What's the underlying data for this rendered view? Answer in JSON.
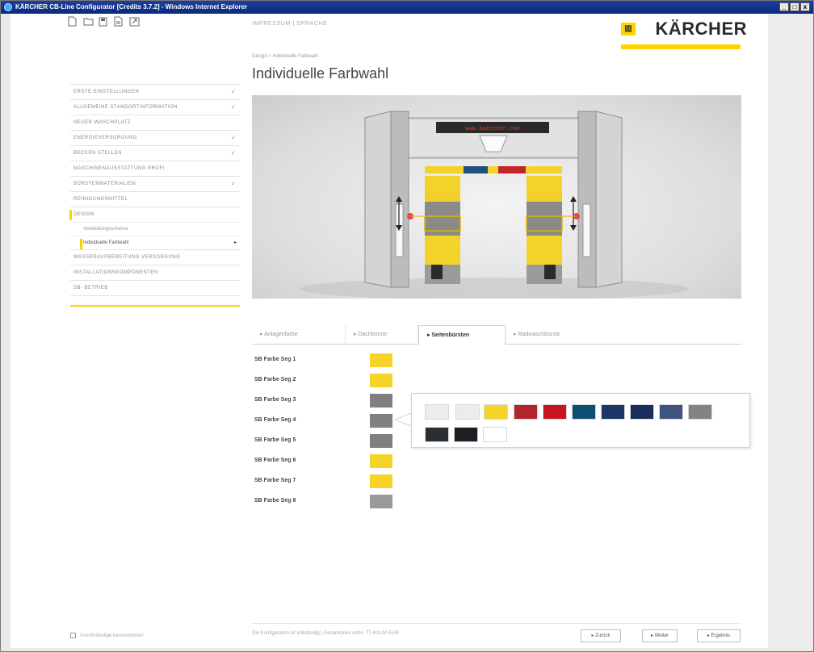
{
  "window": {
    "title": "KÄRCHER CB-Line Configurator [Credits 3.7.2] - Windows Internet Explorer",
    "controls": [
      "_",
      "□",
      "x"
    ]
  },
  "toolbar": {
    "icons": [
      "new-document-icon",
      "open-folder-icon",
      "save-icon",
      "print-icon",
      "export-icon"
    ]
  },
  "top_links": "IMPRESSUM | SPRACHE",
  "logo": {
    "text": "KÄRCHER",
    "accent": "#ffd200"
  },
  "breadcrumb": "Design > Individuelle Farbwahl",
  "page_title": "Individuelle Farbwahl",
  "sidebar": {
    "items": [
      {
        "label": "ERSTE EINSTELLUNGEN",
        "checked": "✓"
      },
      {
        "label": "ALLGEMEINE STANDORTINFORMATION",
        "checked": "✓"
      },
      {
        "label": "NEUER WASCHPLATZ",
        "checked": ""
      },
      {
        "label": "ENERGIEVERSORGUNG",
        "checked": "✓"
      },
      {
        "label": "BECKEN STELLEN",
        "checked": "✓"
      },
      {
        "label": "MASCHINENAUSSTATTUNG PROFI",
        "checked": ""
      },
      {
        "label": "BÜRSTENMATERIALIEN",
        "checked": "✓"
      },
      {
        "label": "REINIGUNGSMITTEL",
        "checked": ""
      },
      {
        "label": "DESIGN",
        "checked": ""
      }
    ],
    "sub_items": [
      {
        "label": "Verkleidungsschema",
        "marker": ""
      },
      {
        "label": "Individuelle Farbwahl",
        "marker": "▸"
      }
    ],
    "items_after": [
      {
        "label": "WASSERAUFBEREITUNG VERSORGUNG",
        "checked": ""
      },
      {
        "label": "INSTALLATIONSKOMPONENTEN",
        "checked": ""
      },
      {
        "label": "SB- BETRIEB",
        "checked": ""
      }
    ]
  },
  "hero": {
    "display_text": "www.kaercher.com"
  },
  "tabs": [
    {
      "label": "▸ Anlagenfarbe"
    },
    {
      "label": "▸ Dachbürste"
    },
    {
      "label": "▸ Seitenbürsten"
    },
    {
      "label": "▸ Radwaschbürste"
    }
  ],
  "segments": [
    {
      "label": "SB Farbe Seg 1",
      "color": "#f5d328"
    },
    {
      "label": "SB Farbe Seg 2",
      "color": "#f5d328"
    },
    {
      "label": "SB Farbe Seg 3",
      "color": "#808080"
    },
    {
      "label": "SB Farbe Seg 4",
      "color": "#808080"
    },
    {
      "label": "SB Farbe Seg 5",
      "color": "#808080"
    },
    {
      "label": "SB Farbe Seg 6",
      "color": "#f5d328"
    },
    {
      "label": "SB Farbe Seg 7",
      "color": "#f5d328"
    },
    {
      "label": "SB Farbe Seg 8",
      "color": "#9a9a9a"
    }
  ],
  "palette": {
    "row1": [
      "#ececec",
      "#ececec",
      "#f5d328",
      "#b0262a",
      "#c8141e",
      "#0e4e73",
      "#1a3566",
      "#1a2e5c",
      "#3f547d",
      "#838383"
    ],
    "row2": [
      "#2b2f34",
      "#1b1e22",
      "#ffffff"
    ]
  },
  "footer": {
    "checkbox_label": "Unvollständige kennzeichnen",
    "status_text": "Die Konfiguration ist vollständig  |  Gesamtpreis netto: 77.400,00 EUR",
    "buttons": {
      "back": "▸ Zurück",
      "next": "▸ Weiter",
      "result": "▸ Ergebnis"
    }
  }
}
